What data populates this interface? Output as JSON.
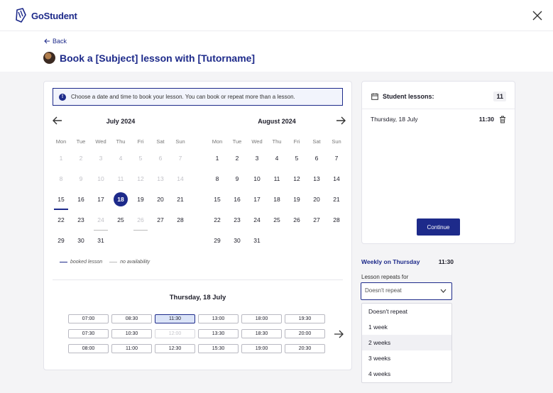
{
  "brand": {
    "name": "GoStudent",
    "color": "#1d2a8a"
  },
  "header": {
    "back_label": "Back",
    "title": "Book a [Subject] lesson with [Tutorname]"
  },
  "info": {
    "text": "Choose a date and time to book your lesson. You can book or repeat more than a lesson."
  },
  "weekdays": [
    "Mon",
    "Tue",
    "Wed",
    "Thu",
    "Fri",
    "Sat",
    "Sun"
  ],
  "july": {
    "title": "July  2024",
    "weeks": [
      [
        {
          "d": "1",
          "s": "disabled"
        },
        {
          "d": "2",
          "s": "disabled"
        },
        {
          "d": "3",
          "s": "disabled"
        },
        {
          "d": "4",
          "s": "disabled"
        },
        {
          "d": "5",
          "s": "disabled"
        },
        {
          "d": "6",
          "s": "disabled"
        },
        {
          "d": "7",
          "s": "disabled"
        }
      ],
      [
        {
          "d": "8",
          "s": "disabled"
        },
        {
          "d": "9",
          "s": "disabled"
        },
        {
          "d": "10",
          "s": "disabled"
        },
        {
          "d": "11",
          "s": "disabled"
        },
        {
          "d": "12",
          "s": "disabled"
        },
        {
          "d": "13",
          "s": "disabled"
        },
        {
          "d": "14",
          "s": "disabled"
        }
      ],
      [
        {
          "d": "15",
          "s": "booked"
        },
        {
          "d": "16",
          "s": ""
        },
        {
          "d": "17",
          "s": ""
        },
        {
          "d": "18",
          "s": "selected"
        },
        {
          "d": "19",
          "s": ""
        },
        {
          "d": "20",
          "s": ""
        },
        {
          "d": "21",
          "s": ""
        }
      ],
      [
        {
          "d": "22",
          "s": ""
        },
        {
          "d": "23",
          "s": ""
        },
        {
          "d": "24",
          "s": "disabled noavail"
        },
        {
          "d": "25",
          "s": ""
        },
        {
          "d": "26",
          "s": "disabled noavail"
        },
        {
          "d": "27",
          "s": ""
        },
        {
          "d": "28",
          "s": ""
        }
      ],
      [
        {
          "d": "29",
          "s": ""
        },
        {
          "d": "30",
          "s": ""
        },
        {
          "d": "31",
          "s": ""
        }
      ]
    ]
  },
  "august": {
    "title": "August  2024",
    "weeks": [
      [
        {
          "d": "1",
          "s": ""
        },
        {
          "d": "2",
          "s": ""
        },
        {
          "d": "3",
          "s": ""
        },
        {
          "d": "4",
          "s": ""
        },
        {
          "d": "5",
          "s": ""
        },
        {
          "d": "6",
          "s": ""
        },
        {
          "d": "7",
          "s": ""
        }
      ],
      [
        {
          "d": "8",
          "s": ""
        },
        {
          "d": "9",
          "s": ""
        },
        {
          "d": "10",
          "s": ""
        },
        {
          "d": "11",
          "s": ""
        },
        {
          "d": "12",
          "s": ""
        },
        {
          "d": "13",
          "s": ""
        },
        {
          "d": "14",
          "s": ""
        }
      ],
      [
        {
          "d": "15",
          "s": ""
        },
        {
          "d": "16",
          "s": ""
        },
        {
          "d": "17",
          "s": ""
        },
        {
          "d": "18",
          "s": ""
        },
        {
          "d": "19",
          "s": ""
        },
        {
          "d": "20",
          "s": ""
        },
        {
          "d": "21",
          "s": ""
        }
      ],
      [
        {
          "d": "22",
          "s": ""
        },
        {
          "d": "23",
          "s": ""
        },
        {
          "d": "24",
          "s": ""
        },
        {
          "d": "25",
          "s": ""
        },
        {
          "d": "26",
          "s": ""
        },
        {
          "d": "27",
          "s": ""
        },
        {
          "d": "28",
          "s": ""
        }
      ],
      [
        {
          "d": "29",
          "s": ""
        },
        {
          "d": "30",
          "s": ""
        },
        {
          "d": "31",
          "s": ""
        }
      ]
    ]
  },
  "legend": {
    "booked": "booked lesson",
    "none": "no availability"
  },
  "slots": {
    "title": "Thursday, 18 July",
    "times": [
      {
        "t": "07:00",
        "s": ""
      },
      {
        "t": "08:30",
        "s": ""
      },
      {
        "t": "11:30",
        "s": "selected"
      },
      {
        "t": "13:00",
        "s": ""
      },
      {
        "t": "18:00",
        "s": ""
      },
      {
        "t": "19:30",
        "s": ""
      },
      {
        "t": "07:30",
        "s": ""
      },
      {
        "t": "10:30",
        "s": ""
      },
      {
        "t": "12:00",
        "s": "disabled"
      },
      {
        "t": "13:30",
        "s": ""
      },
      {
        "t": "18:30",
        "s": ""
      },
      {
        "t": "20:00",
        "s": ""
      },
      {
        "t": "08:00",
        "s": ""
      },
      {
        "t": "11:00",
        "s": ""
      },
      {
        "t": "12:30",
        "s": ""
      },
      {
        "t": "15:30",
        "s": ""
      },
      {
        "t": "19:00",
        "s": ""
      },
      {
        "t": "20:30",
        "s": ""
      }
    ]
  },
  "summary": {
    "title": "Student lessons:",
    "count": "11",
    "lesson_date": "Thursday, 18 July",
    "lesson_time": "11:30",
    "continue_label": "Continue"
  },
  "repeat": {
    "weekly_label": "Weekly on Thursday",
    "weekly_time": "11:30",
    "label": "Lesson repeats for",
    "selected": "Doesn't repeat",
    "options": [
      "Doesn't repeat",
      "1 week",
      "2 weeks",
      "3 weeks",
      "4 weeks"
    ],
    "active_option": "2 weeks"
  }
}
